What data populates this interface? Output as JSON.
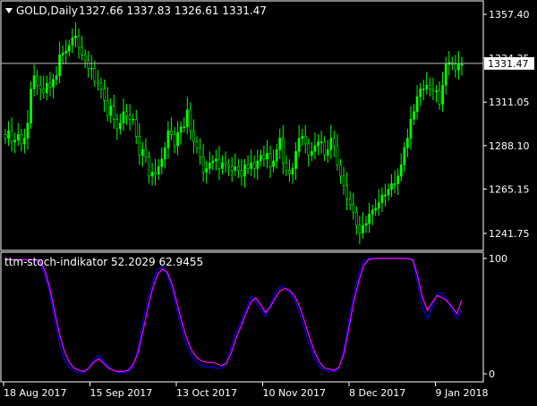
{
  "header": {
    "symbol": "GOLD,Daily",
    "ohlc": "1327.66 1337.83 1326.61 1331.47"
  },
  "price_axis": {
    "ticks": [
      "1357.40",
      "1334.35",
      "1311.05",
      "1288.10",
      "1265.15",
      "1241.75"
    ],
    "current_price_label": "1331.47"
  },
  "indicator": {
    "label": "ttm-stoch-indikator 52.2029 62.9455",
    "ticks": [
      "100",
      "0"
    ]
  },
  "time_axis": {
    "labels": [
      "18 Aug 2017",
      "15 Sep 2017",
      "13 Oct 2017",
      "10 Nov 2017",
      "8 Dec 2017",
      "9 Jan 2018"
    ]
  },
  "colors": {
    "background": "#000000",
    "bull_candle": "#00ff00",
    "bear_candle": "#000000",
    "wick": "#00ff00",
    "price_line": "#c0c0c0",
    "stoch_main": "#ff00ff",
    "stoch_signal": "#0000ff",
    "axis": "#ffffff"
  },
  "chart_data": [
    {
      "type": "candlestick",
      "title": "GOLD,Daily",
      "y_ticks": [
        1241.75,
        1265.15,
        1288.1,
        1311.05,
        1334.35,
        1357.4
      ],
      "current_price": 1331.47,
      "series": [
        {
          "values": [
            1292,
            1296,
            1290,
            1291,
            1294,
            1289,
            1292,
            1300,
            1318,
            1325,
            1320,
            1318,
            1316,
            1321,
            1319,
            1323,
            1325,
            1336,
            1337,
            1338,
            1341,
            1345,
            1346,
            1340,
            1336,
            1333,
            1329,
            1329,
            1322,
            1321,
            1318,
            1312,
            1304,
            1309,
            1302,
            1297,
            1300,
            1306,
            1304,
            1302,
            1302,
            1293,
            1283,
            1286,
            1282,
            1272,
            1274,
            1273,
            1277,
            1281,
            1287,
            1296,
            1294,
            1288,
            1295,
            1298,
            1298,
            1307,
            1296,
            1290,
            1287,
            1282,
            1274,
            1276,
            1279,
            1280,
            1281,
            1276,
            1279,
            1278,
            1277,
            1275,
            1277,
            1275,
            1272,
            1278,
            1276,
            1279,
            1276,
            1280,
            1283,
            1281,
            1284,
            1277,
            1280,
            1286,
            1292,
            1279,
            1275,
            1273,
            1276,
            1285,
            1292,
            1293,
            1289,
            1283,
            1285,
            1288,
            1290,
            1290,
            1283,
            1286,
            1292,
            1288,
            1278,
            1272,
            1267,
            1260,
            1257,
            1253,
            1246,
            1242,
            1246,
            1247,
            1252,
            1254,
            1255,
            1258,
            1262,
            1262,
            1265,
            1268,
            1268,
            1272,
            1278,
            1287,
            1292,
            1302,
            1306,
            1314,
            1318,
            1318,
            1320,
            1318,
            1317,
            1317,
            1310,
            1320,
            1331,
            1332,
            1331,
            1328,
            1331,
            1331
          ]
        }
      ]
    },
    {
      "type": "line",
      "title": "ttm-stoch-indikator 52.2029 62.9455",
      "y_ticks": [
        0,
        100
      ],
      "ylim": [
        0,
        100
      ],
      "series": [
        {
          "values": [
            100,
            99,
            99,
            99,
            99,
            99,
            99,
            98,
            90,
            75,
            55,
            35,
            20,
            10,
            5,
            3,
            2,
            5,
            10,
            13,
            9,
            5,
            3,
            2,
            2,
            3,
            8,
            18,
            36,
            56,
            74,
            86,
            91,
            88,
            77,
            61,
            44,
            30,
            20,
            14,
            11,
            10,
            10,
            9,
            7,
            9,
            18,
            31,
            41,
            52,
            62,
            66,
            60,
            53,
            58,
            66,
            72,
            74,
            72,
            67,
            58,
            45,
            31,
            19,
            10,
            5,
            4,
            3,
            6,
            18,
            40,
            63,
            80,
            94,
            99,
            100,
            100,
            100,
            100,
            100,
            100,
            100,
            100,
            99,
            85,
            66,
            55,
            62,
            68,
            66,
            63,
            58,
            52,
            64
          ]
        },
        {
          "values": [
            100,
            99,
            99,
            99,
            99,
            99,
            98,
            96,
            86,
            70,
            48,
            27,
            12,
            6,
            2,
            1,
            1,
            5,
            12,
            16,
            11,
            6,
            3,
            1,
            1,
            2,
            6,
            22,
            44,
            64,
            80,
            90,
            93,
            86,
            72,
            54,
            37,
            24,
            15,
            10,
            7,
            6,
            6,
            5,
            5,
            9,
            24,
            36,
            45,
            56,
            67,
            62,
            56,
            50,
            60,
            70,
            76,
            74,
            70,
            63,
            52,
            38,
            24,
            13,
            6,
            3,
            2,
            2,
            5,
            22,
            47,
            70,
            87,
            97,
            100,
            100,
            100,
            100,
            100,
            100,
            100,
            100,
            100,
            98,
            78,
            57,
            48,
            58,
            70,
            70,
            64,
            55,
            48,
            56
          ]
        }
      ]
    }
  ]
}
